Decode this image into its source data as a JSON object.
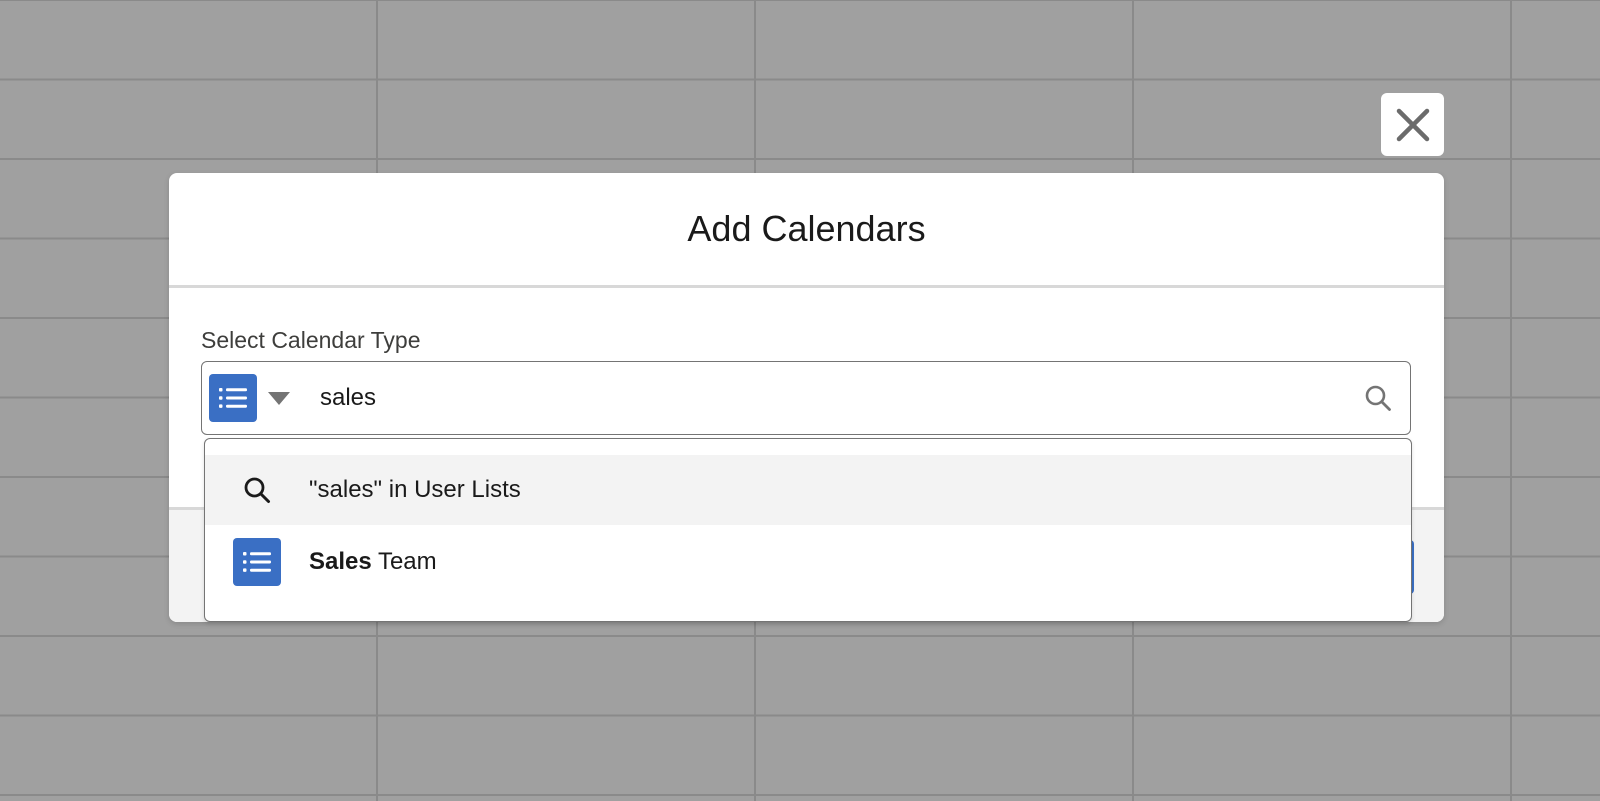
{
  "modal": {
    "title": "Add Calendars",
    "field_label": "Select Calendar Type",
    "search_value": "sales",
    "selected_type_icon": "list-icon"
  },
  "dropdown": {
    "search_option": {
      "icon": "search-icon",
      "label": "\"sales\" in User Lists"
    },
    "results": [
      {
        "icon": "list-icon",
        "label_match": "Sales",
        "label_rest": " Team"
      }
    ]
  },
  "colors": {
    "accent": "#3a6fc4",
    "backdrop": "#a0a0a0",
    "highlight_row": "#f3f3f3"
  }
}
